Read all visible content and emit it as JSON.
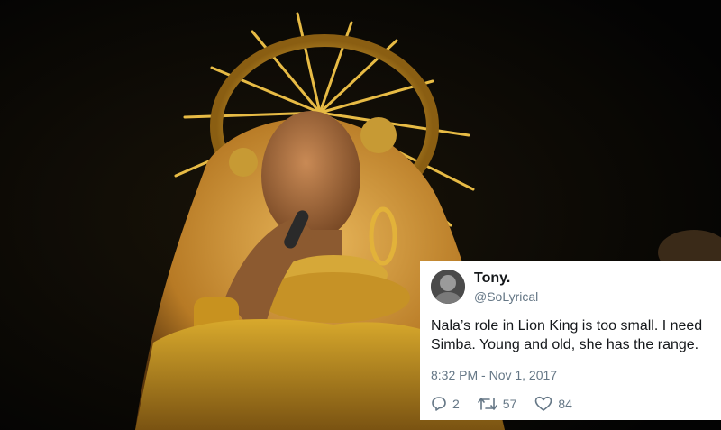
{
  "tweet": {
    "display_name": "Tony.",
    "handle": "@SoLyrical",
    "text_line1": "Nala’s role in Lion King is too small. I need",
    "text_line2": "Simba. Young and old, she has the range.",
    "timestamp": "8:32 PM - Nov 1, 2017",
    "replies": "2",
    "retweets": "57",
    "likes": "84"
  },
  "colors": {
    "background": "#050505",
    "gold": "#d8a92c",
    "tweet_text": "#14171a",
    "tweet_secondary": "#657786"
  },
  "icons": [
    "reply-icon",
    "retweet-icon",
    "heart-icon"
  ]
}
